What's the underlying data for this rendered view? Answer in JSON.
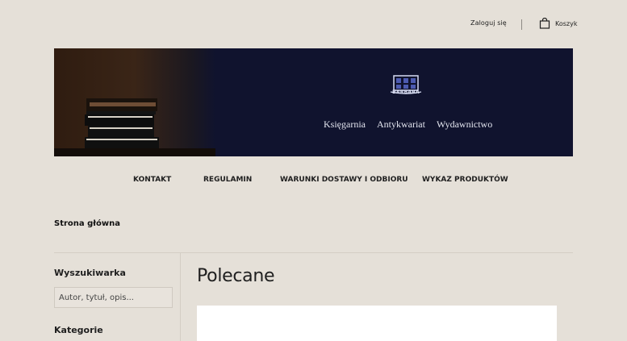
{
  "header": {
    "login_label": "Zaloguj się",
    "cart_label": "Koszyk",
    "cart_icon": "shopping-bag-icon"
  },
  "banner": {
    "logo_text": "BARBARA",
    "logo_icon": "bookshelf-logo-icon",
    "nav": [
      "Księgarnia",
      "Antykwariat",
      "Wydawnictwo"
    ]
  },
  "main_nav": [
    "KONTAKT",
    "REGULAMIN",
    "WARUNKI DOSTAWY I ODBIORU",
    "WYKAZ PRODUKTÓW"
  ],
  "breadcrumb": "Strona główna",
  "sidebar": {
    "search_title": "Wyszukiwarka",
    "search_placeholder": "Autor, tytuł, opis...",
    "categories_title": "Kategorie"
  },
  "content": {
    "section_title": "Polecane"
  },
  "colors": {
    "page_background": "#e5e0d8",
    "banner_background": "#10132e",
    "text": "#1f1f1f"
  }
}
